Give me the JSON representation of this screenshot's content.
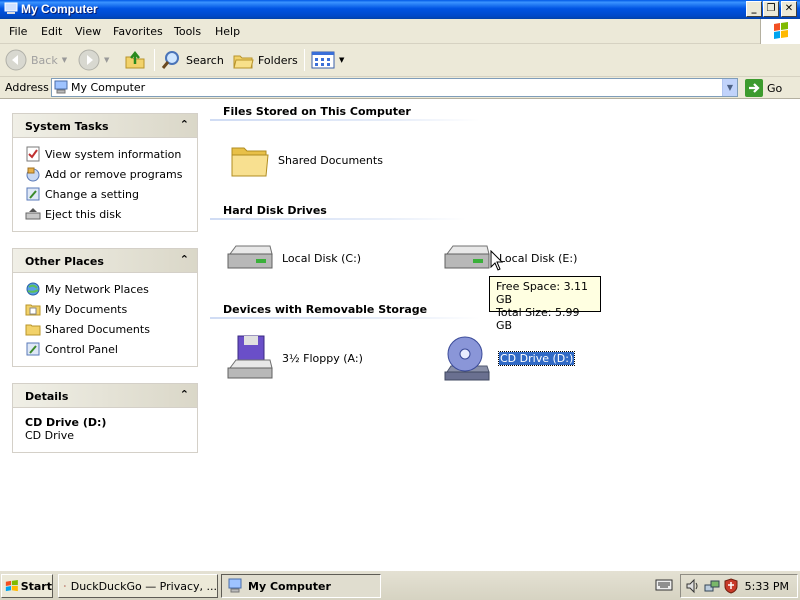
{
  "window": {
    "title": "My Computer",
    "controls": {
      "minimize": "_",
      "maximize": "❐",
      "close": "✕"
    }
  },
  "menubar": [
    "File",
    "Edit",
    "View",
    "Favorites",
    "Tools",
    "Help"
  ],
  "toolbar": {
    "back": "Back",
    "search": "Search",
    "folders": "Folders"
  },
  "address": {
    "label": "Address",
    "value": "My Computer",
    "go": "Go"
  },
  "left_pane": {
    "system_tasks": {
      "title": "System Tasks",
      "items": [
        "View system information",
        "Add or remove programs",
        "Change a setting",
        "Eject this disk"
      ]
    },
    "other_places": {
      "title": "Other Places",
      "items": [
        "My Network Places",
        "My Documents",
        "Shared Documents",
        "Control Panel"
      ]
    },
    "details": {
      "title": "Details",
      "name": "CD Drive (D:)",
      "type": "CD Drive"
    }
  },
  "content": {
    "groups": [
      {
        "title": "Files Stored on This Computer",
        "items": [
          {
            "label": "Shared Documents",
            "icon": "folder-icon"
          }
        ]
      },
      {
        "title": "Hard Disk Drives",
        "items": [
          {
            "label": "Local Disk (C:)",
            "icon": "hard-disk-icon"
          },
          {
            "label": "Local Disk (E:)",
            "icon": "hard-disk-icon"
          }
        ]
      },
      {
        "title": "Devices with Removable Storage",
        "items": [
          {
            "label": "3½ Floppy (A:)",
            "icon": "floppy-drive-icon"
          },
          {
            "label": "CD Drive (D:)",
            "icon": "cd-drive-icon",
            "selected": true
          }
        ]
      }
    ],
    "tooltip": {
      "free_space": "Free Space: 3.11 GB",
      "total_size": "Total Size: 5.99 GB"
    }
  },
  "taskbar": {
    "start": "Start",
    "tasks": [
      {
        "label": "DuckDuckGo — Privacy, ...",
        "active": false
      },
      {
        "label": "My Computer",
        "active": true
      }
    ],
    "clock": "5:33 PM"
  },
  "colors": {
    "title_bar": "#0054e3",
    "selection": "#316ac5",
    "tooltip_bg": "#ffffe1"
  }
}
